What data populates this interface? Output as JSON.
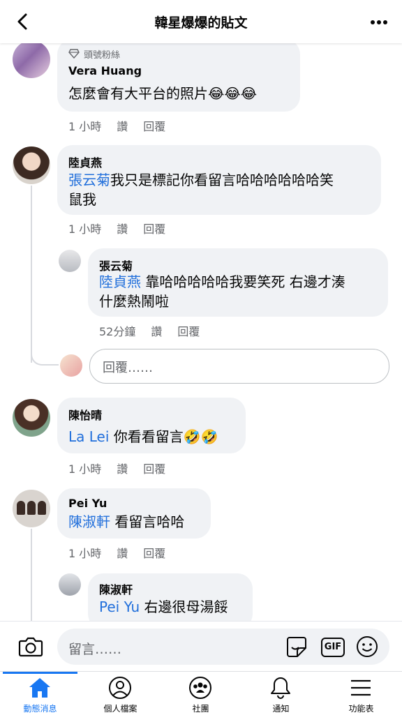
{
  "header": {
    "title": "韓星爆爆的貼文"
  },
  "comments": [
    {
      "badge": "頭號粉絲",
      "name": "Vera Huang",
      "text": "怎麼會有大平台的照片😂😂😂",
      "time": "1 小時",
      "like": "讚",
      "reply": "回覆"
    },
    {
      "name": "陸貞燕",
      "mention": "張云菊",
      "text_line1": "我只是標記你看留言哈哈哈哈哈哈笑",
      "text_line2": "鼠我",
      "time": "1 小時",
      "like": "讚",
      "reply": "回覆",
      "replies": [
        {
          "name": "張云菊",
          "mention": "陸貞燕",
          "text_line1": " 靠哈哈哈哈哈我要笑死 右邊才湊",
          "text_line2": "什麼熱鬧啦",
          "time": "52分鐘",
          "like": "讚",
          "reply": "回覆"
        }
      ],
      "reply_placeholder": "回覆……"
    },
    {
      "name": "陳怡晴",
      "mention": "La Lei",
      "text": " 你看看留言🤣🤣",
      "time": "1 小時",
      "like": "讚",
      "reply": "回覆"
    },
    {
      "name": "Pei Yu",
      "mention": "陳淑軒",
      "text": " 看留言哈哈",
      "time": "1 小時",
      "like": "讚",
      "reply": "回覆",
      "replies": [
        {
          "name": "陳淑軒",
          "mention": "Pei Yu",
          "text": " 右邊很母湯餒"
        }
      ]
    }
  ],
  "composer": {
    "placeholder": "留言……",
    "gif_label": "GIF"
  },
  "tabbar": [
    {
      "label": "動態消息",
      "icon": "home-icon",
      "active": true
    },
    {
      "label": "個人檔案",
      "icon": "profile-icon"
    },
    {
      "label": "社團",
      "icon": "groups-icon"
    },
    {
      "label": "通知",
      "icon": "bell-icon"
    },
    {
      "label": "功能表",
      "icon": "menu-icon"
    }
  ],
  "colors": {
    "accent": "#1877f2",
    "mention": "#216fdb",
    "bubble": "#f0f2f5"
  }
}
